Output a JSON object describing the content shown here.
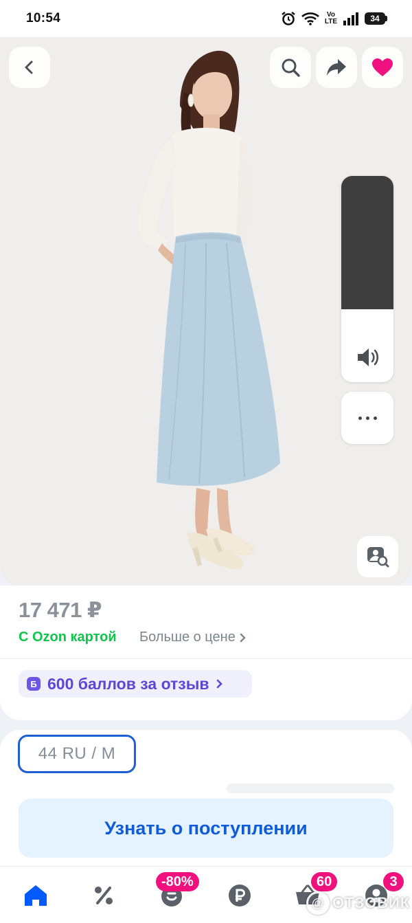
{
  "status_bar": {
    "time": "10:54",
    "network_label": "Vo\nLTE",
    "battery_level": "34",
    "icons": [
      "alarm-icon",
      "wifi-icon",
      "volte-icon",
      "signal-icon",
      "battery-icon"
    ]
  },
  "gallery": {
    "photo_description": "product-photo-woman-in-light-blue-midi-skirt",
    "top_actions": [
      "back-icon",
      "search-icon",
      "share-icon",
      "heart-icon"
    ],
    "favorite_active": true,
    "colors": {
      "favorite": "#f1117e",
      "skirt": "#b9d0e0",
      "volume_dark": "#3e3e3e"
    },
    "volume_level": 0.35
  },
  "price_block": {
    "price": "17 471 ₽",
    "ozon_card_label": "С Ozon картой",
    "more_about_price": "Больше о цене",
    "bonus_badge": "Б",
    "bonus_text": "600 баллов за отзыв"
  },
  "size_block": {
    "selected_size": "44 RU / M"
  },
  "notify_button": "Узнать о поступлении",
  "bottom_nav": {
    "items": [
      {
        "name": "home",
        "icon": "home-icon",
        "active": true
      },
      {
        "name": "sale",
        "icon": "percent-icon"
      },
      {
        "name": "fresh",
        "icon": "bag-icon",
        "badge": "-80%"
      },
      {
        "name": "finance",
        "icon": "ruble-icon"
      },
      {
        "name": "cart",
        "icon": "basket-icon",
        "badge": "60"
      },
      {
        "name": "profile",
        "icon": "profile-icon",
        "badge": "3"
      }
    ],
    "accent_color": "#005bff",
    "badge_color": "#f1117e"
  },
  "watermark": {
    "logo_letter": "@",
    "text": "ОТЗОВИК"
  }
}
